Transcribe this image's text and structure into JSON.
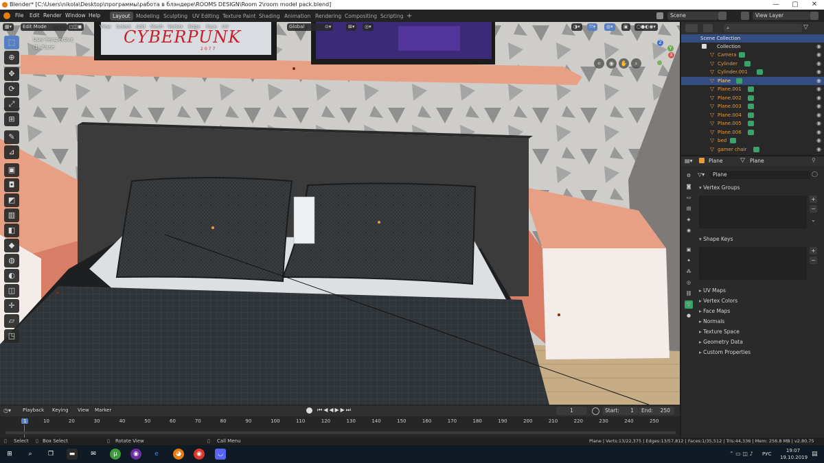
{
  "window": {
    "title": "Blender* [C:\\Users\\nikola\\Desktop\\программы\\работа в блэндере\\ROOMS DESIGN\\Room 2\\room model pack.blend]",
    "minimize": "—",
    "maximize": "▢",
    "close": "✕"
  },
  "menu": [
    "File",
    "Edit",
    "Render",
    "Window",
    "Help"
  ],
  "workspaces": {
    "tabs": [
      "Layout",
      "Modeling",
      "Sculpting",
      "UV Editing",
      "Texture Paint",
      "Shading",
      "Animation",
      "Rendering",
      "Compositing",
      "Scripting"
    ],
    "active": "Layout",
    "add": "+"
  },
  "scene": {
    "scene_name": "Scene",
    "view_layer": "View Layer"
  },
  "viewport_header": {
    "mode": "Edit Mode",
    "menus": [
      "View",
      "Select",
      "Add",
      "Mesh",
      "Vertex",
      "Edge",
      "Face",
      "UV"
    ],
    "orientation": "Global"
  },
  "viewport": {
    "overlay_line1": "User Perspective",
    "overlay_line2": "(1) Plane",
    "poster1_text": "CYBERPUNK",
    "poster1_sub": "2077",
    "gizmo": {
      "z": "Z",
      "y": "Y",
      "x": "X"
    }
  },
  "colors": {
    "accent_blue": "#5680c2",
    "selection_blue": "#334d80",
    "object_orange": "#e69c3a",
    "modifier_green": "#3aa36c",
    "wall_salmon": "#e8a085",
    "pillow_dark": "#3a3d40"
  },
  "outliner": {
    "root": "Scene Collection",
    "collection": "Collection",
    "items": [
      {
        "name": "Camera",
        "selected": false
      },
      {
        "name": "Cylinder",
        "selected": false
      },
      {
        "name": "Cylinder.001",
        "selected": false
      },
      {
        "name": "Plane",
        "selected": true
      },
      {
        "name": "Plane.001",
        "selected": false
      },
      {
        "name": "Plane.002",
        "selected": false
      },
      {
        "name": "Plane.003",
        "selected": false
      },
      {
        "name": "Plane.004",
        "selected": false
      },
      {
        "name": "Plane.005",
        "selected": false
      },
      {
        "name": "Plane.006",
        "selected": false
      },
      {
        "name": "bed",
        "selected": false
      },
      {
        "name": "gamer chair",
        "selected": false
      }
    ]
  },
  "properties": {
    "object_name": "Plane",
    "data_name": "Plane",
    "mesh_field": "Plane",
    "sections": [
      "Vertex Groups",
      "Shape Keys",
      "UV Maps",
      "Vertex Colors",
      "Face Maps",
      "Normals",
      "Texture Space",
      "Geometry Data",
      "Custom Properties"
    ]
  },
  "timeline": {
    "menus": [
      "Playback",
      "Keying",
      "View",
      "Marker"
    ],
    "current_frame": "1",
    "start_label": "Start:",
    "start": "1",
    "end_label": "End:",
    "end": "250",
    "ticks": [
      "1",
      "10",
      "20",
      "30",
      "40",
      "50",
      "60",
      "70",
      "80",
      "90",
      "100",
      "110",
      "120",
      "130",
      "140",
      "150",
      "160",
      "170",
      "180",
      "190",
      "200",
      "210",
      "220",
      "230",
      "240",
      "250"
    ]
  },
  "statusbar": {
    "select": "Select",
    "box_select": "Box Select",
    "rotate": "Rotate View",
    "call_menu": "Call Menu",
    "stats": "Plane | Verts:13/22,375 | Edges:13/57,812 | Faces:1/35,512 | Tris:44,336 | Mem: 256.8 MB | v2.80.75"
  },
  "taskbar": {
    "lang": "РУС",
    "time": "19:07",
    "date": "19.10.2019"
  }
}
